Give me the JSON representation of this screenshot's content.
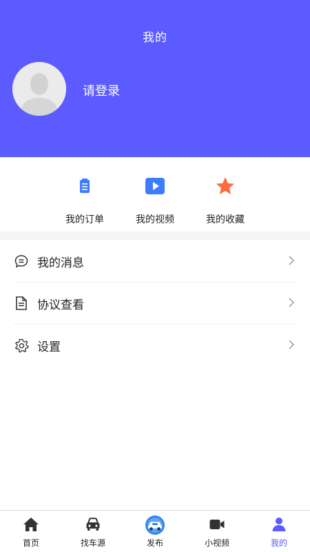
{
  "header": {
    "title": "我的",
    "login_prompt": "请登录",
    "background_color": "#5b5bff"
  },
  "shortcuts": [
    {
      "label": "我的订单",
      "icon": "clipboard-icon",
      "color": "#3d7bff"
    },
    {
      "label": "我的视频",
      "icon": "video-icon",
      "color": "#3d7bff"
    },
    {
      "label": "我的收藏",
      "icon": "star-icon",
      "color": "#ff6a3d"
    }
  ],
  "menu": [
    {
      "label": "我的消息",
      "icon": "message-icon"
    },
    {
      "label": "协议查看",
      "icon": "document-icon"
    },
    {
      "label": "设置",
      "icon": "gear-icon"
    }
  ],
  "tabbar": {
    "active_color": "#5b5bff",
    "items": [
      {
        "label": "首页",
        "icon": "home-icon"
      },
      {
        "label": "找车源",
        "icon": "car-icon"
      },
      {
        "label": "发布",
        "icon": "publish-icon"
      },
      {
        "label": "小视频",
        "icon": "video-camera-icon"
      },
      {
        "label": "我的",
        "icon": "person-icon",
        "active": true
      }
    ]
  }
}
